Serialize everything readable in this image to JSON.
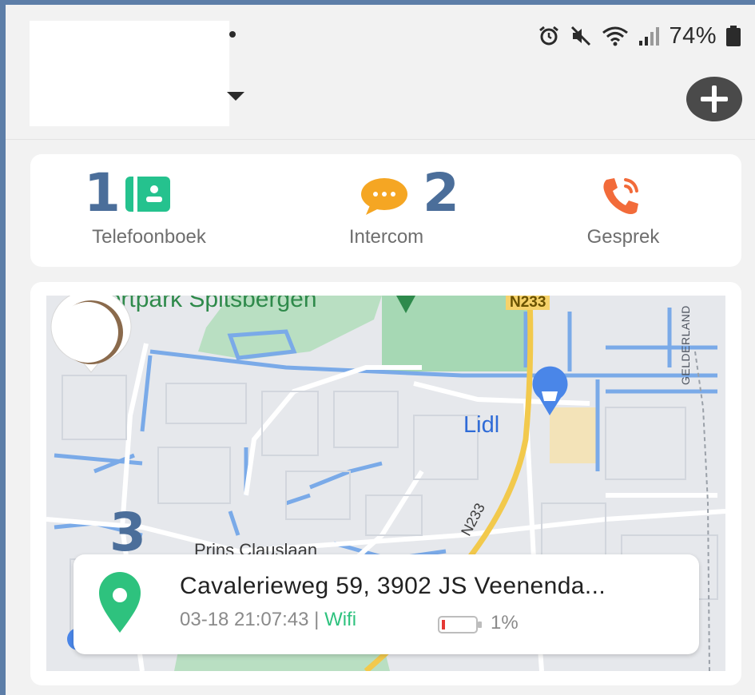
{
  "status_bar": {
    "battery_percent": "74%",
    "icons": [
      "alarm-icon",
      "mute-icon",
      "wifi-icon",
      "signal-icon",
      "battery-icon"
    ]
  },
  "header": {
    "add_button_icon": "plus-icon"
  },
  "actions": [
    {
      "label": "Telefoonboek",
      "icon": "contact-card-icon",
      "color": "#25c28e",
      "marker": "1"
    },
    {
      "label": "Intercom",
      "icon": "chat-bubble-icon",
      "color": "#f5a623",
      "marker": "2"
    },
    {
      "label": "Gesprek",
      "icon": "phone-call-icon",
      "color": "#f26b3a"
    }
  ],
  "map": {
    "labels": {
      "sportpark": "Sportpark Spitsbergen",
      "n233_top": "N233",
      "lidl": "Lidl",
      "gelderland": "GELDERLAND",
      "n233_road": "N233",
      "prins": "Prins Clauslaan"
    },
    "marker": "3"
  },
  "location": {
    "address": "Cavalerieweg 59, 3902 JS Veenenda...",
    "timestamp": "03-18 21:07:43",
    "separator": "|",
    "connection": "Wifi",
    "battery": "1%",
    "pin_color": "#2ec27e"
  }
}
